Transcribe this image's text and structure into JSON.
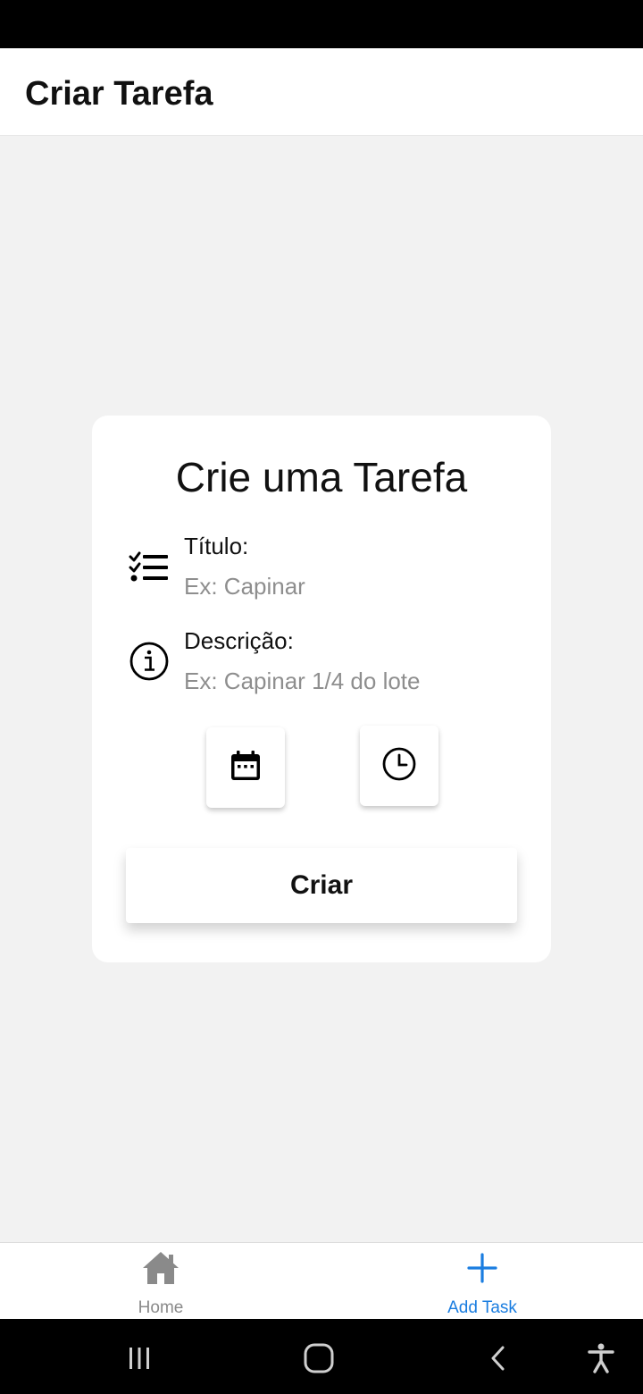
{
  "header": {
    "title": "Criar Tarefa"
  },
  "card": {
    "title": "Crie uma Tarefa",
    "fields": [
      {
        "label": "Título:",
        "placeholder": "Ex: Capinar",
        "value": "",
        "icon": "checklist-icon"
      },
      {
        "label": "Descrição:",
        "placeholder": "Ex: Capinar 1/4 do lote",
        "value": "",
        "icon": "info-icon"
      }
    ],
    "date_button_icon": "calendar-icon",
    "time_button_icon": "clock-icon",
    "submit_label": "Criar"
  },
  "tabs": [
    {
      "label": "Home",
      "icon": "home-icon",
      "active": false
    },
    {
      "label": "Add Task",
      "icon": "plus-icon",
      "active": true
    }
  ],
  "colors": {
    "accent": "#1a7de0",
    "inactive": "#8a8a8a",
    "background": "#f2f2f2"
  },
  "system_nav": [
    "recent-apps-icon",
    "home-circle-icon",
    "back-icon",
    "accessibility-icon"
  ]
}
